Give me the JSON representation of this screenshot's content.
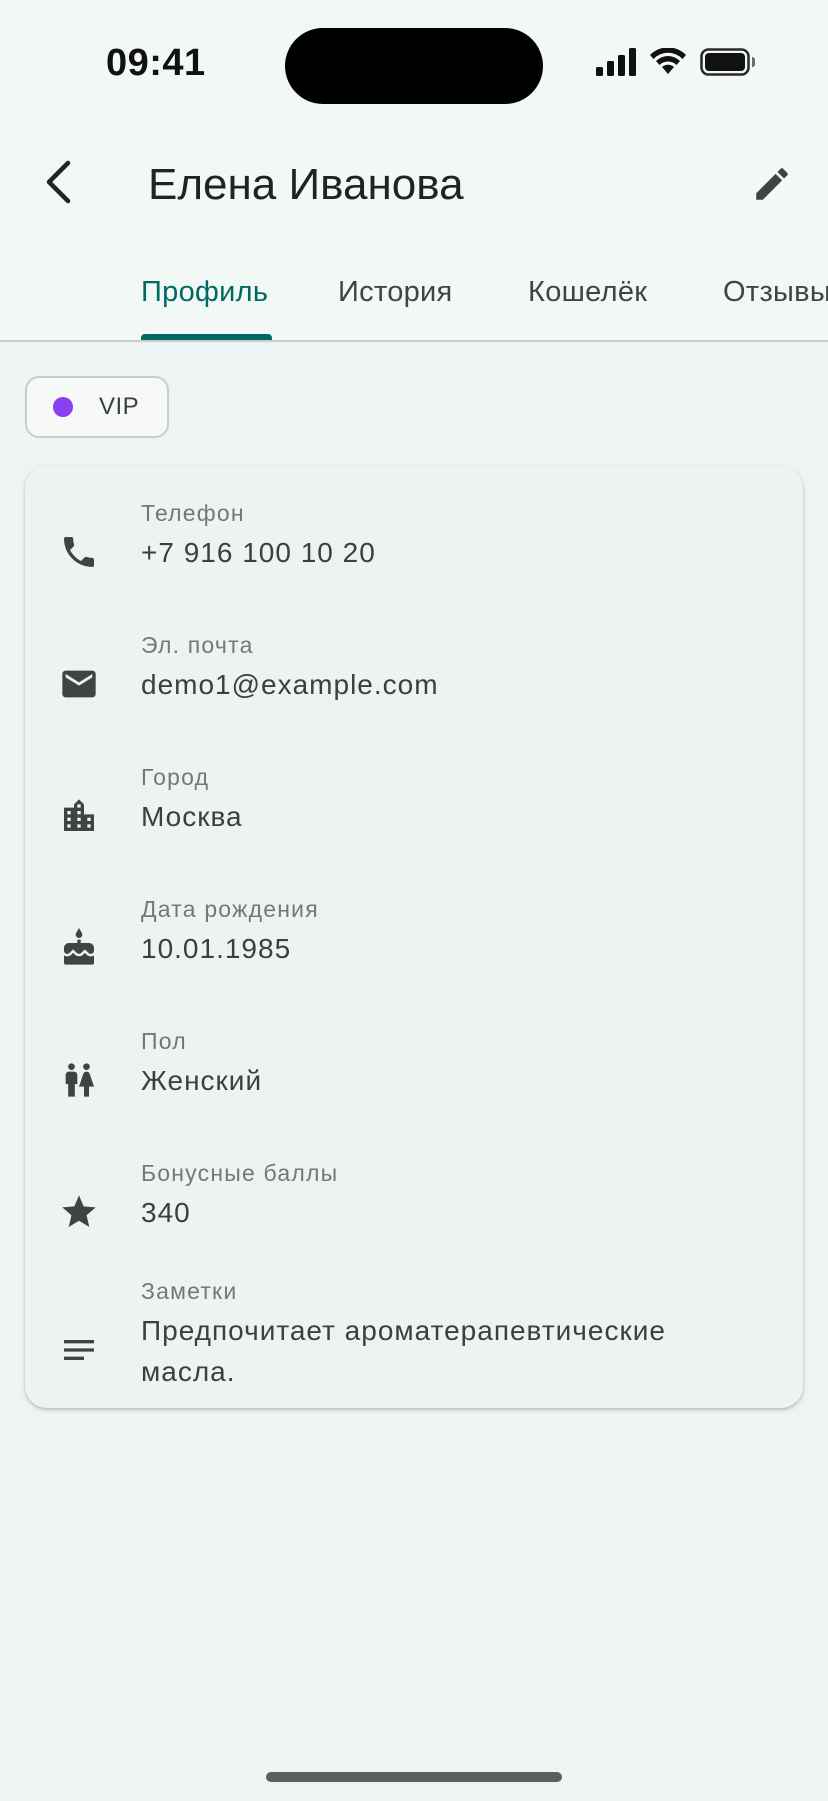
{
  "status_bar": {
    "time": "09:41",
    "icons": [
      "signal-icon",
      "wifi-icon",
      "battery-icon"
    ]
  },
  "app_bar": {
    "title": "Елена Иванова",
    "back_icon": "chevron-left-icon",
    "edit_icon": "pencil-icon"
  },
  "tabs": [
    {
      "label": "Профиль",
      "active": true
    },
    {
      "label": "История",
      "active": false
    },
    {
      "label": "Кошелёк",
      "active": false
    },
    {
      "label": "Отзывы",
      "active": false
    }
  ],
  "chip": {
    "label": "VIP",
    "dot_color": "#8a3ff0"
  },
  "details": [
    {
      "icon": "phone-icon",
      "label": "Телефон",
      "value": "+7 916 100 10 20"
    },
    {
      "icon": "mail-icon",
      "label": "Эл. почта",
      "value": "demo1@example.com"
    },
    {
      "icon": "building-icon",
      "label": "Город",
      "value": "Москва"
    },
    {
      "icon": "cake-icon",
      "label": "Дата рождения",
      "value": "10.01.1985"
    },
    {
      "icon": "wc-icon",
      "label": "Пол",
      "value": "Женский"
    },
    {
      "icon": "star-icon",
      "label": "Бонусные баллы",
      "value": "340"
    },
    {
      "icon": "notes-icon",
      "label": "Заметки",
      "value": "Предпочитает ароматерапевтические масла."
    }
  ],
  "colors": {
    "accent": "#006a62",
    "background": "#eef4f3",
    "icon": "#3d4443"
  }
}
